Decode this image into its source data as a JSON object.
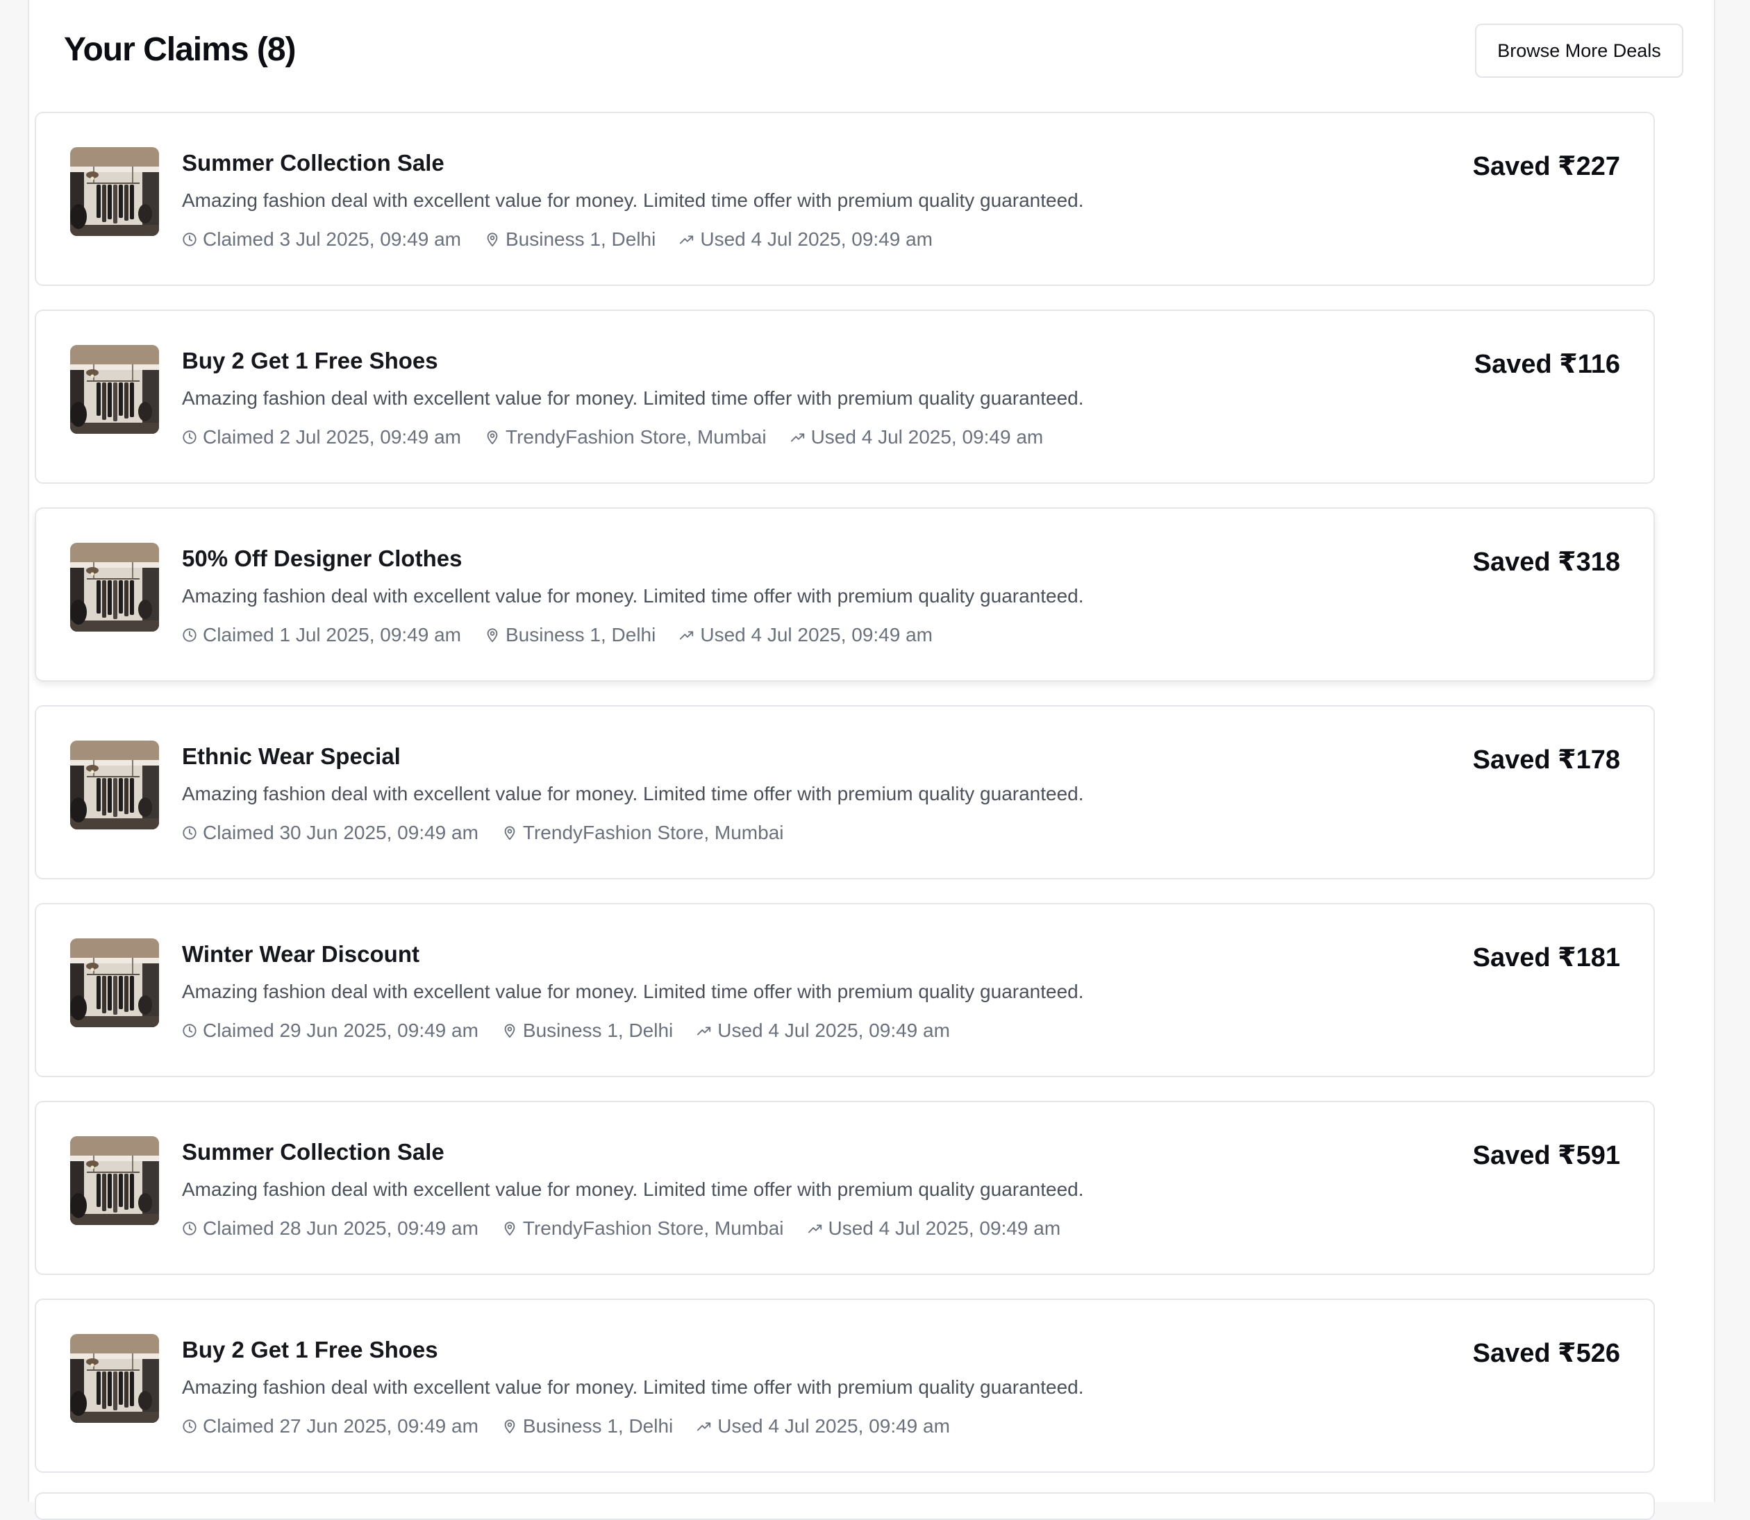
{
  "header": {
    "title": "Your Claims (8)",
    "browse_label": "Browse More Deals"
  },
  "colors": {
    "meta_text": "#6b717c",
    "border": "#e4e6ea"
  },
  "claims": [
    {
      "title": "Summer Collection Sale",
      "description": "Amazing fashion deal with excellent value for money. Limited time offer with premium quality guaranteed.",
      "claimed": "Claimed 3 Jul 2025, 09:49 am",
      "location": "Business 1, Delhi",
      "used": "Used 4 Jul 2025, 09:49 am",
      "saved": "Saved ₹227"
    },
    {
      "title": "Buy 2 Get 1 Free Shoes",
      "description": "Amazing fashion deal with excellent value for money. Limited time offer with premium quality guaranteed.",
      "claimed": "Claimed 2 Jul 2025, 09:49 am",
      "location": "TrendyFashion Store, Mumbai",
      "used": "Used 4 Jul 2025, 09:49 am",
      "saved": "Saved ₹116"
    },
    {
      "title": "50% Off Designer Clothes",
      "description": "Amazing fashion deal with excellent value for money. Limited time offer with premium quality guaranteed.",
      "claimed": "Claimed 1 Jul 2025, 09:49 am",
      "location": "Business 1, Delhi",
      "used": "Used 4 Jul 2025, 09:49 am",
      "saved": "Saved ₹318"
    },
    {
      "title": "Ethnic Wear Special",
      "description": "Amazing fashion deal with excellent value for money. Limited time offer with premium quality guaranteed.",
      "claimed": "Claimed 30 Jun 2025, 09:49 am",
      "location": "TrendyFashion Store, Mumbai",
      "used": null,
      "saved": "Saved ₹178"
    },
    {
      "title": "Winter Wear Discount",
      "description": "Amazing fashion deal with excellent value for money. Limited time offer with premium quality guaranteed.",
      "claimed": "Claimed 29 Jun 2025, 09:49 am",
      "location": "Business 1, Delhi",
      "used": "Used 4 Jul 2025, 09:49 am",
      "saved": "Saved ₹181"
    },
    {
      "title": "Summer Collection Sale",
      "description": "Amazing fashion deal with excellent value for money. Limited time offer with premium quality guaranteed.",
      "claimed": "Claimed 28 Jun 2025, 09:49 am",
      "location": "TrendyFashion Store, Mumbai",
      "used": "Used 4 Jul 2025, 09:49 am",
      "saved": "Saved ₹591"
    },
    {
      "title": "Buy 2 Get 1 Free Shoes",
      "description": "Amazing fashion deal with excellent value for money. Limited time offer with premium quality guaranteed.",
      "claimed": "Claimed 27 Jun 2025, 09:49 am",
      "location": "Business 1, Delhi",
      "used": "Used 4 Jul 2025, 09:49 am",
      "saved": "Saved ₹526"
    }
  ],
  "icons": {
    "claimed": "clock-icon",
    "location": "map-pin-icon",
    "used": "trending-up-icon"
  }
}
